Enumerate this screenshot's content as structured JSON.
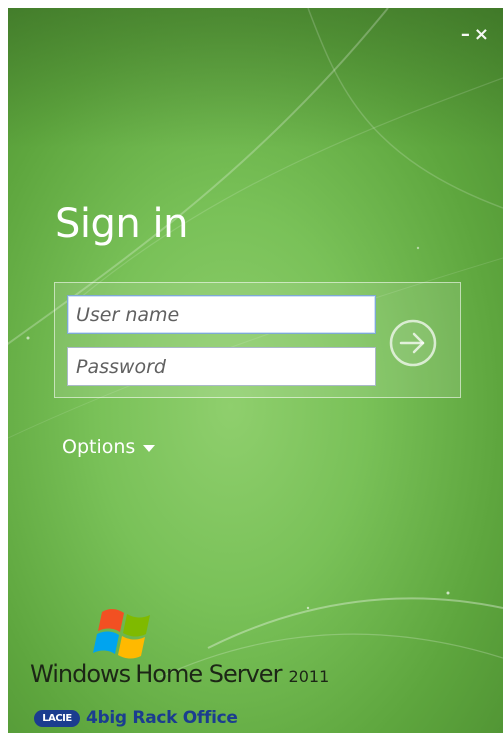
{
  "window": {
    "minimize_glyph": "–",
    "close_glyph": "×"
  },
  "signin": {
    "title": "Sign in",
    "username_placeholder": "User name",
    "username_value": "",
    "password_placeholder": "Password",
    "password_value": "",
    "submit_icon": "arrow-right-circle-icon",
    "options_label": "Options"
  },
  "branding": {
    "logo_icon": "windows-flag-icon",
    "product_word1": "Windows",
    "product_word2": "Home Server",
    "product_year": "2011",
    "vendor_badge": "LACIE",
    "vendor_product": "4big Rack Office"
  },
  "colors": {
    "background_green": "#79c158",
    "vendor_blue": "#1b3d8f",
    "text_white": "#ffffff"
  }
}
